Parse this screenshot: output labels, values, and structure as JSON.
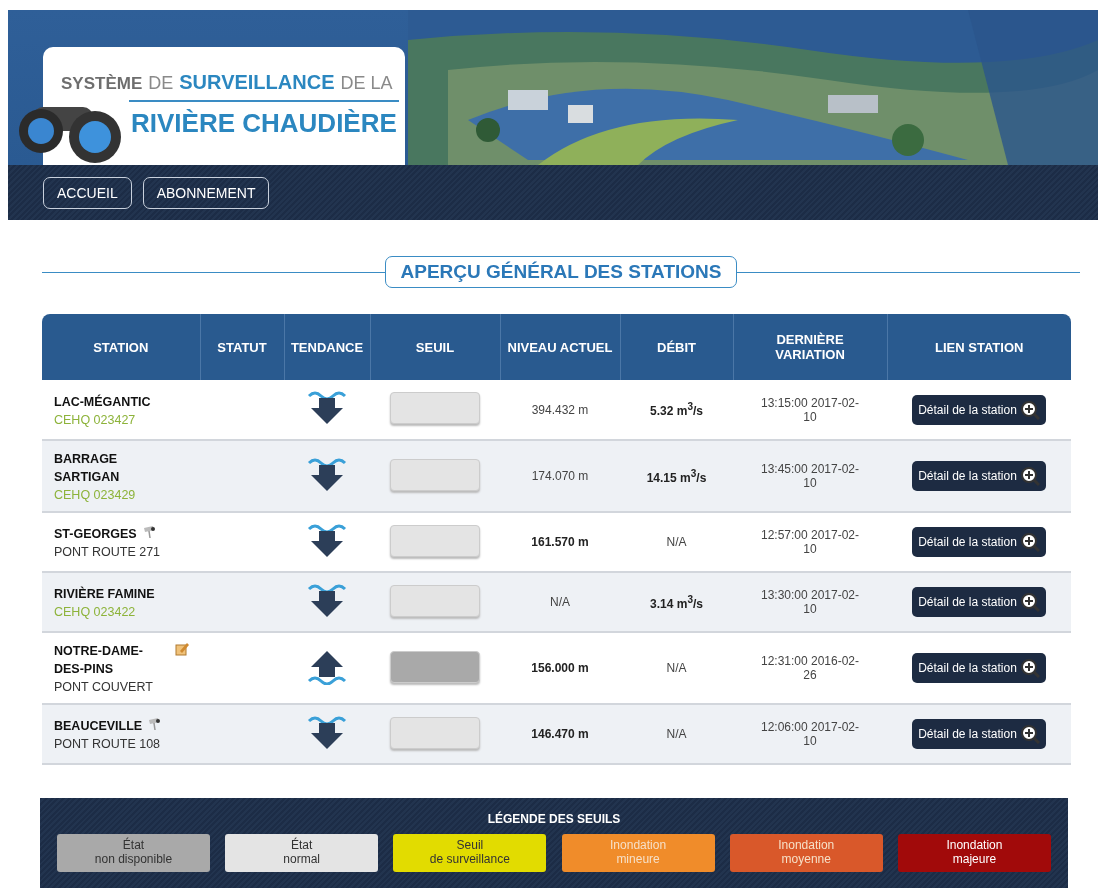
{
  "logo": {
    "line1": [
      {
        "text": "SYSTÈME",
        "kind": "gray-bold"
      },
      {
        "text": "DE",
        "kind": "gray"
      },
      {
        "text": "SURVEILLANCE",
        "kind": "blue-bold"
      },
      {
        "text": "DE LA",
        "kind": "gray"
      }
    ],
    "line2": "RIVIÈRE CHAUDIÈRE"
  },
  "nav": [
    "ACCUEIL",
    "ABONNEMENT"
  ],
  "section_title": "APERÇU GÉNÉRAL DES STATIONS",
  "table": {
    "columns": [
      "STATION",
      "STATUT",
      "TENDANCE",
      "SEUIL",
      "NIVEAU ACTUEL",
      "DÉBIT",
      "DERNIÈRE VARIATION",
      "LIEN STATION"
    ],
    "rows": [
      {
        "station": "LAC-MÉGANTIC",
        "sub": {
          "text": "CEHQ 023427",
          "kind": "code"
        },
        "trend": {
          "kind": "down"
        },
        "seuil": {
          "color": "#e4e4e4"
        },
        "niveau": {
          "text": "394.432 m",
          "bold": false
        },
        "debit": {
          "text": "5.32 m$^{3}$/s",
          "bold": true
        },
        "variation": "13:15:00 2017-02-10",
        "link": "Détail de la station"
      },
      {
        "station": "BARRAGE SARTIGAN",
        "sub": {
          "text": "CEHQ 023429",
          "kind": "code"
        },
        "trend": {
          "kind": "down"
        },
        "seuil": {
          "color": "#e4e4e4"
        },
        "niveau": {
          "text": "174.070 m",
          "bold": false
        },
        "debit": {
          "text": "14.15 m$^{3}$/s",
          "bold": true
        },
        "variation": "13:45:00 2017-02-10",
        "link": "Détail de la station"
      },
      {
        "station": "ST-GEORGES",
        "sub": {
          "text": "PONT ROUTE 271",
          "kind": "place"
        },
        "icon": {
          "kind": "camera"
        },
        "trend": {
          "kind": "down"
        },
        "seuil": {
          "color": "#e4e4e4"
        },
        "niveau": {
          "text": "161.570 m",
          "bold": true
        },
        "debit": {
          "text": "N/A",
          "bold": false
        },
        "variation": "12:57:00 2017-02-10",
        "link": "Détail de la station"
      },
      {
        "station": "RIVIÈRE FAMINE",
        "sub": {
          "text": "CEHQ 023422",
          "kind": "code"
        },
        "trend": {
          "kind": "down"
        },
        "seuil": {
          "color": "#e4e4e4"
        },
        "niveau": {
          "text": "N/A",
          "bold": false
        },
        "debit": {
          "text": "3.14 m$^{3}$/s",
          "bold": true
        },
        "variation": "13:30:00 2017-02-10",
        "link": "Détail de la station"
      },
      {
        "station": "NOTRE-DAME-DES-PINS",
        "sub": {
          "text": "PONT COUVERT",
          "kind": "place"
        },
        "icon": {
          "kind": "note"
        },
        "trend": {
          "kind": "up"
        },
        "seuil": {
          "color": "#a9a9a9"
        },
        "niveau": {
          "text": "156.000 m",
          "bold": true
        },
        "debit": {
          "text": "N/A",
          "bold": false
        },
        "variation": "12:31:00 2016-02-26",
        "link": "Détail de la station"
      },
      {
        "station": "BEAUCEVILLE",
        "sub": {
          "text": "PONT ROUTE 108",
          "kind": "place"
        },
        "icon": {
          "kind": "camera"
        },
        "trend": {
          "kind": "down"
        },
        "seuil": {
          "color": "#e4e4e4"
        },
        "niveau": {
          "text": "146.470 m",
          "bold": true
        },
        "debit": {
          "text": "N/A",
          "bold": false
        },
        "variation": "12:06:00 2017-02-10",
        "link": "Détail de la station"
      }
    ]
  },
  "legend": {
    "title": "LÉGENDE DES SEUILS",
    "items": [
      {
        "line1": "État",
        "line2": "non disponible",
        "color": "#a9a9a9"
      },
      {
        "line1": "État",
        "line2": "normal",
        "color": "#e4e4e4"
      },
      {
        "line1": "Seuil",
        "line2": "de surveillance",
        "color": "#e2dc00"
      },
      {
        "line1": "Inondation",
        "line2": "mineure",
        "color": "#f08c2a"
      },
      {
        "line1": "Inondation",
        "line2": "moyenne",
        "color": "#d9582a"
      },
      {
        "line1": "Inondation",
        "line2": "majeure",
        "color": "#a10a0a"
      }
    ]
  }
}
